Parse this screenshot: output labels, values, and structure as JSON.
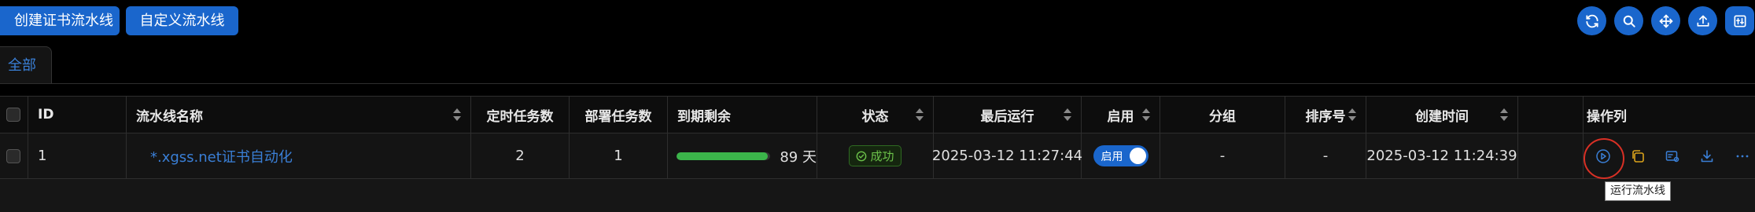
{
  "toolbar": {
    "create_label": "创建证书流水线",
    "custom_label": "自定义流水线",
    "icons": [
      "refresh-icon",
      "search-icon",
      "move-icon",
      "upload-icon",
      "column-settings-icon"
    ]
  },
  "tabs": [
    {
      "label": "全部",
      "active": true
    }
  ],
  "table": {
    "headers": {
      "id": "ID",
      "name": "流水线名称",
      "scheduled": "定时任务数",
      "deploy": "部署任务数",
      "expiry": "到期剩余",
      "status": "状态",
      "last_run": "最后运行",
      "enabled": "启用",
      "group": "分组",
      "order": "排序号",
      "created": "创建时间",
      "actions": "操作列"
    },
    "rows": [
      {
        "id": "1",
        "name": "*.xgss.net证书自动化",
        "scheduled": "2",
        "deploy": "1",
        "expiry_progress": 0.97,
        "expiry_days": "89 天",
        "status": "成功",
        "last_run": "2025-03-12 11:27:44",
        "enabled_label": "启用",
        "enabled": true,
        "group": "-",
        "order": "-",
        "created": "2025-03-12 11:24:39"
      }
    ]
  },
  "tooltip": "运行流水线",
  "colors": {
    "primary": "#1a66cc",
    "link": "#3a7fd6",
    "success": "#6cc24a",
    "progress": "#3bb44a",
    "highlight": "#d93025"
  }
}
